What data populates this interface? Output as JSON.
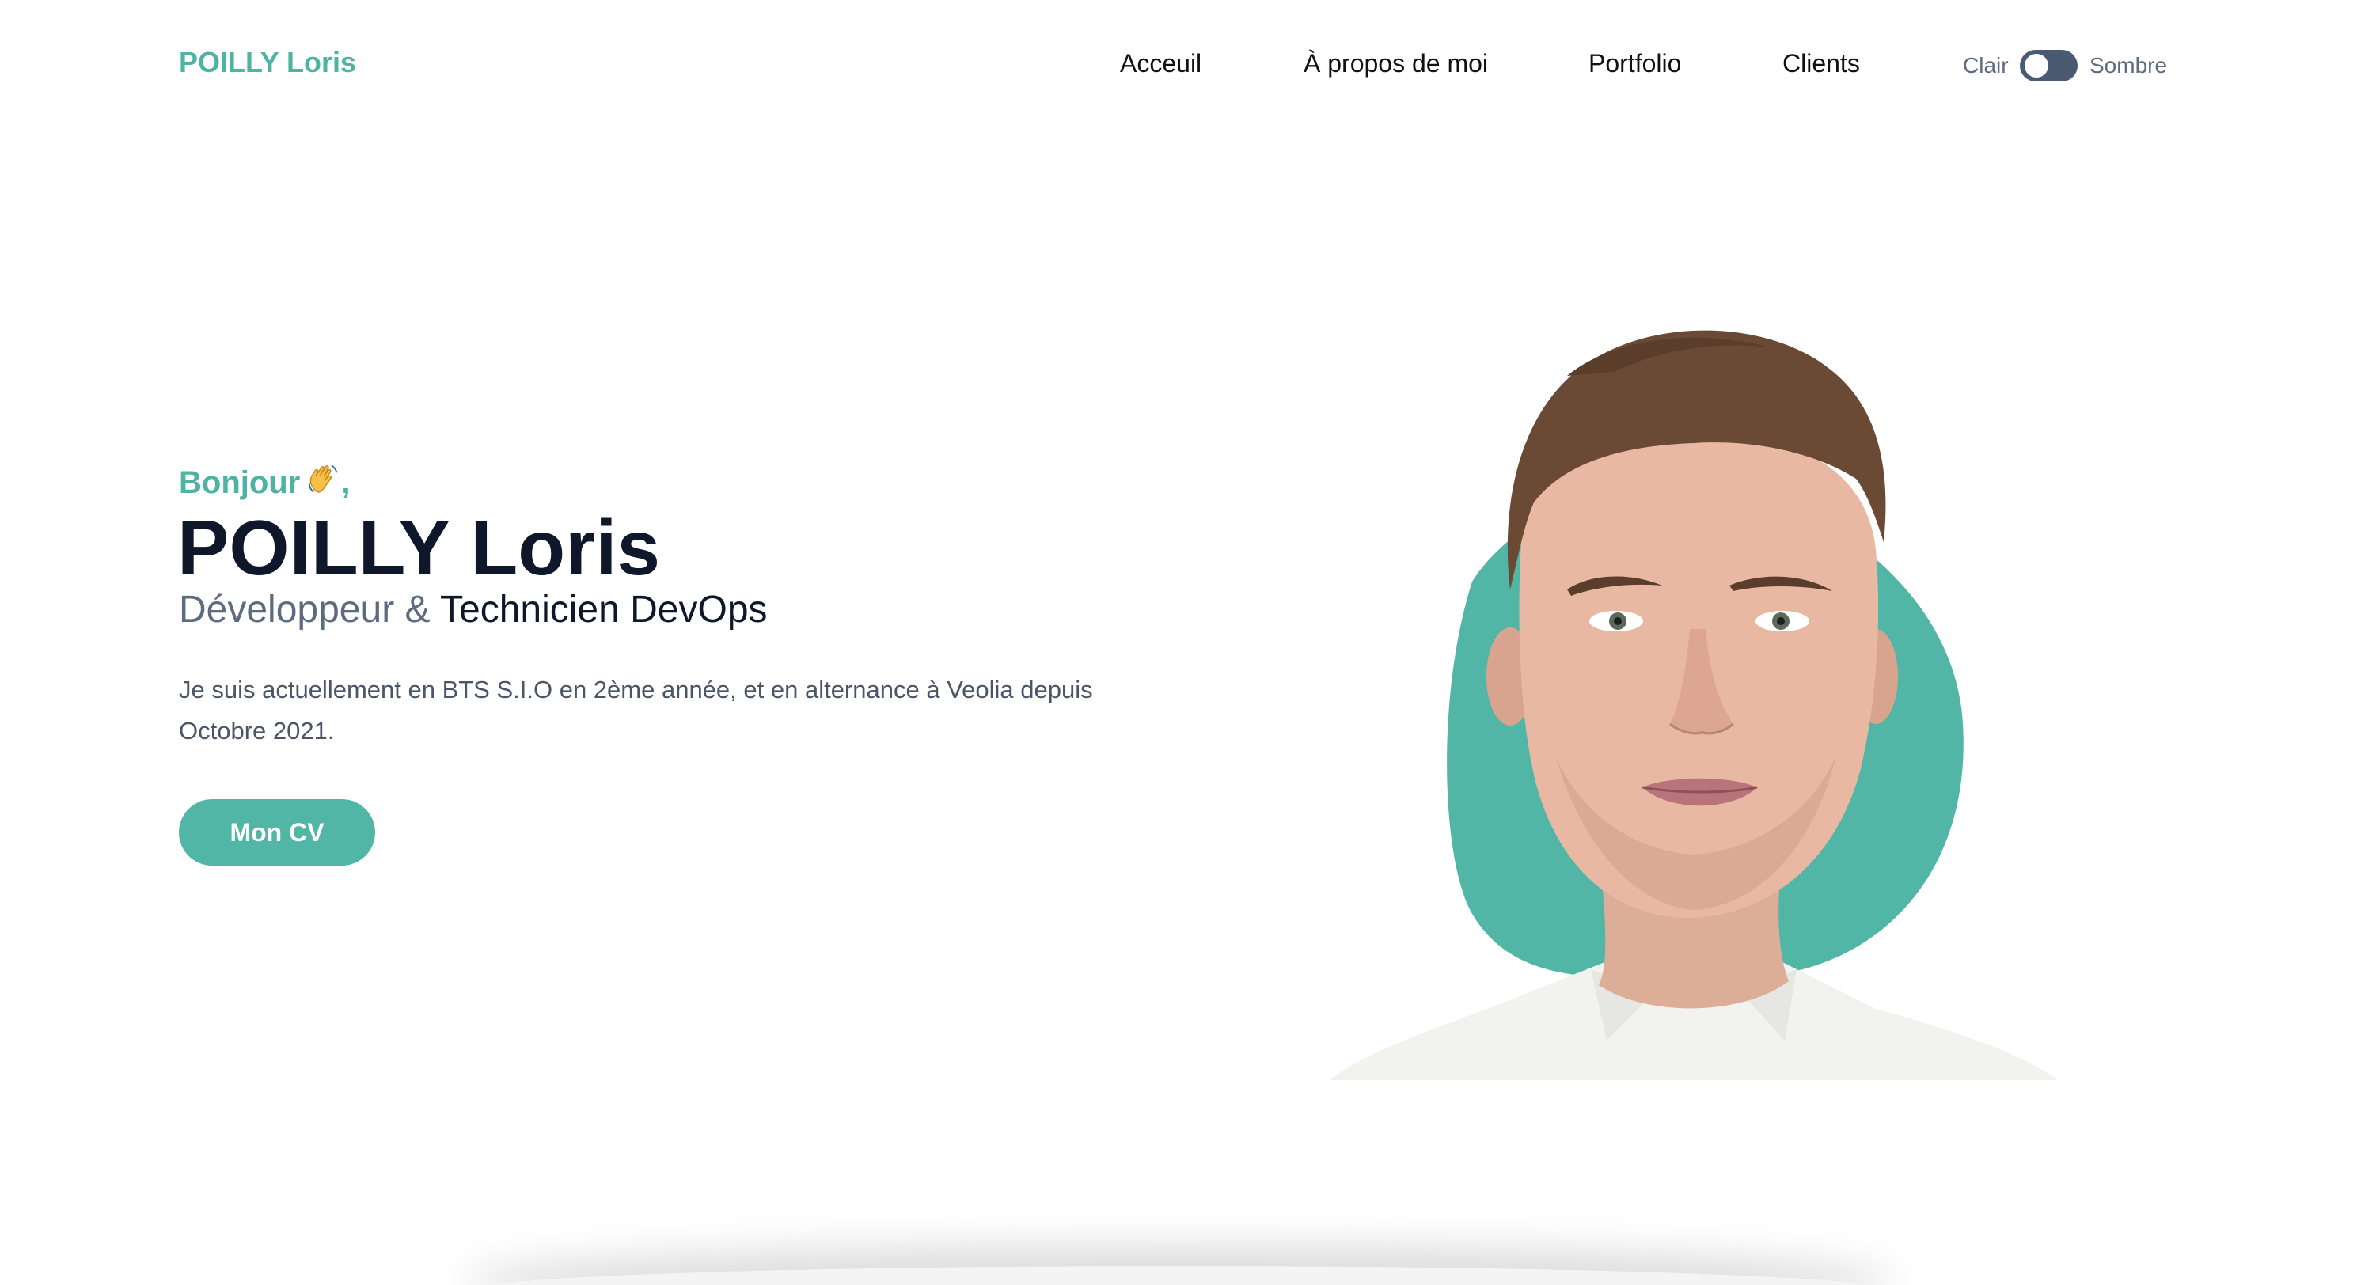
{
  "header": {
    "logo": "POILLY Loris",
    "nav": [
      "Acceuil",
      "À propos de moi",
      "Portfolio",
      "Clients"
    ],
    "theme": {
      "light_label": "Clair",
      "dark_label": "Sombre"
    }
  },
  "hero": {
    "greeting": "Bonjour",
    "greeting_suffix": ",",
    "name": "POILLY Loris",
    "role_prefix": "Développeur &",
    "role_suffix": "Technicien DevOps",
    "description": "Je suis actuellement en BTS S.I.O en 2ème année, et en alternance à Veolia depuis Octobre 2021.",
    "cta_label": "Mon CV"
  },
  "colors": {
    "accent": "#4fb3a4",
    "heading": "#0f172a",
    "muted": "#5d6b80",
    "toggle": "#4a5a72"
  }
}
